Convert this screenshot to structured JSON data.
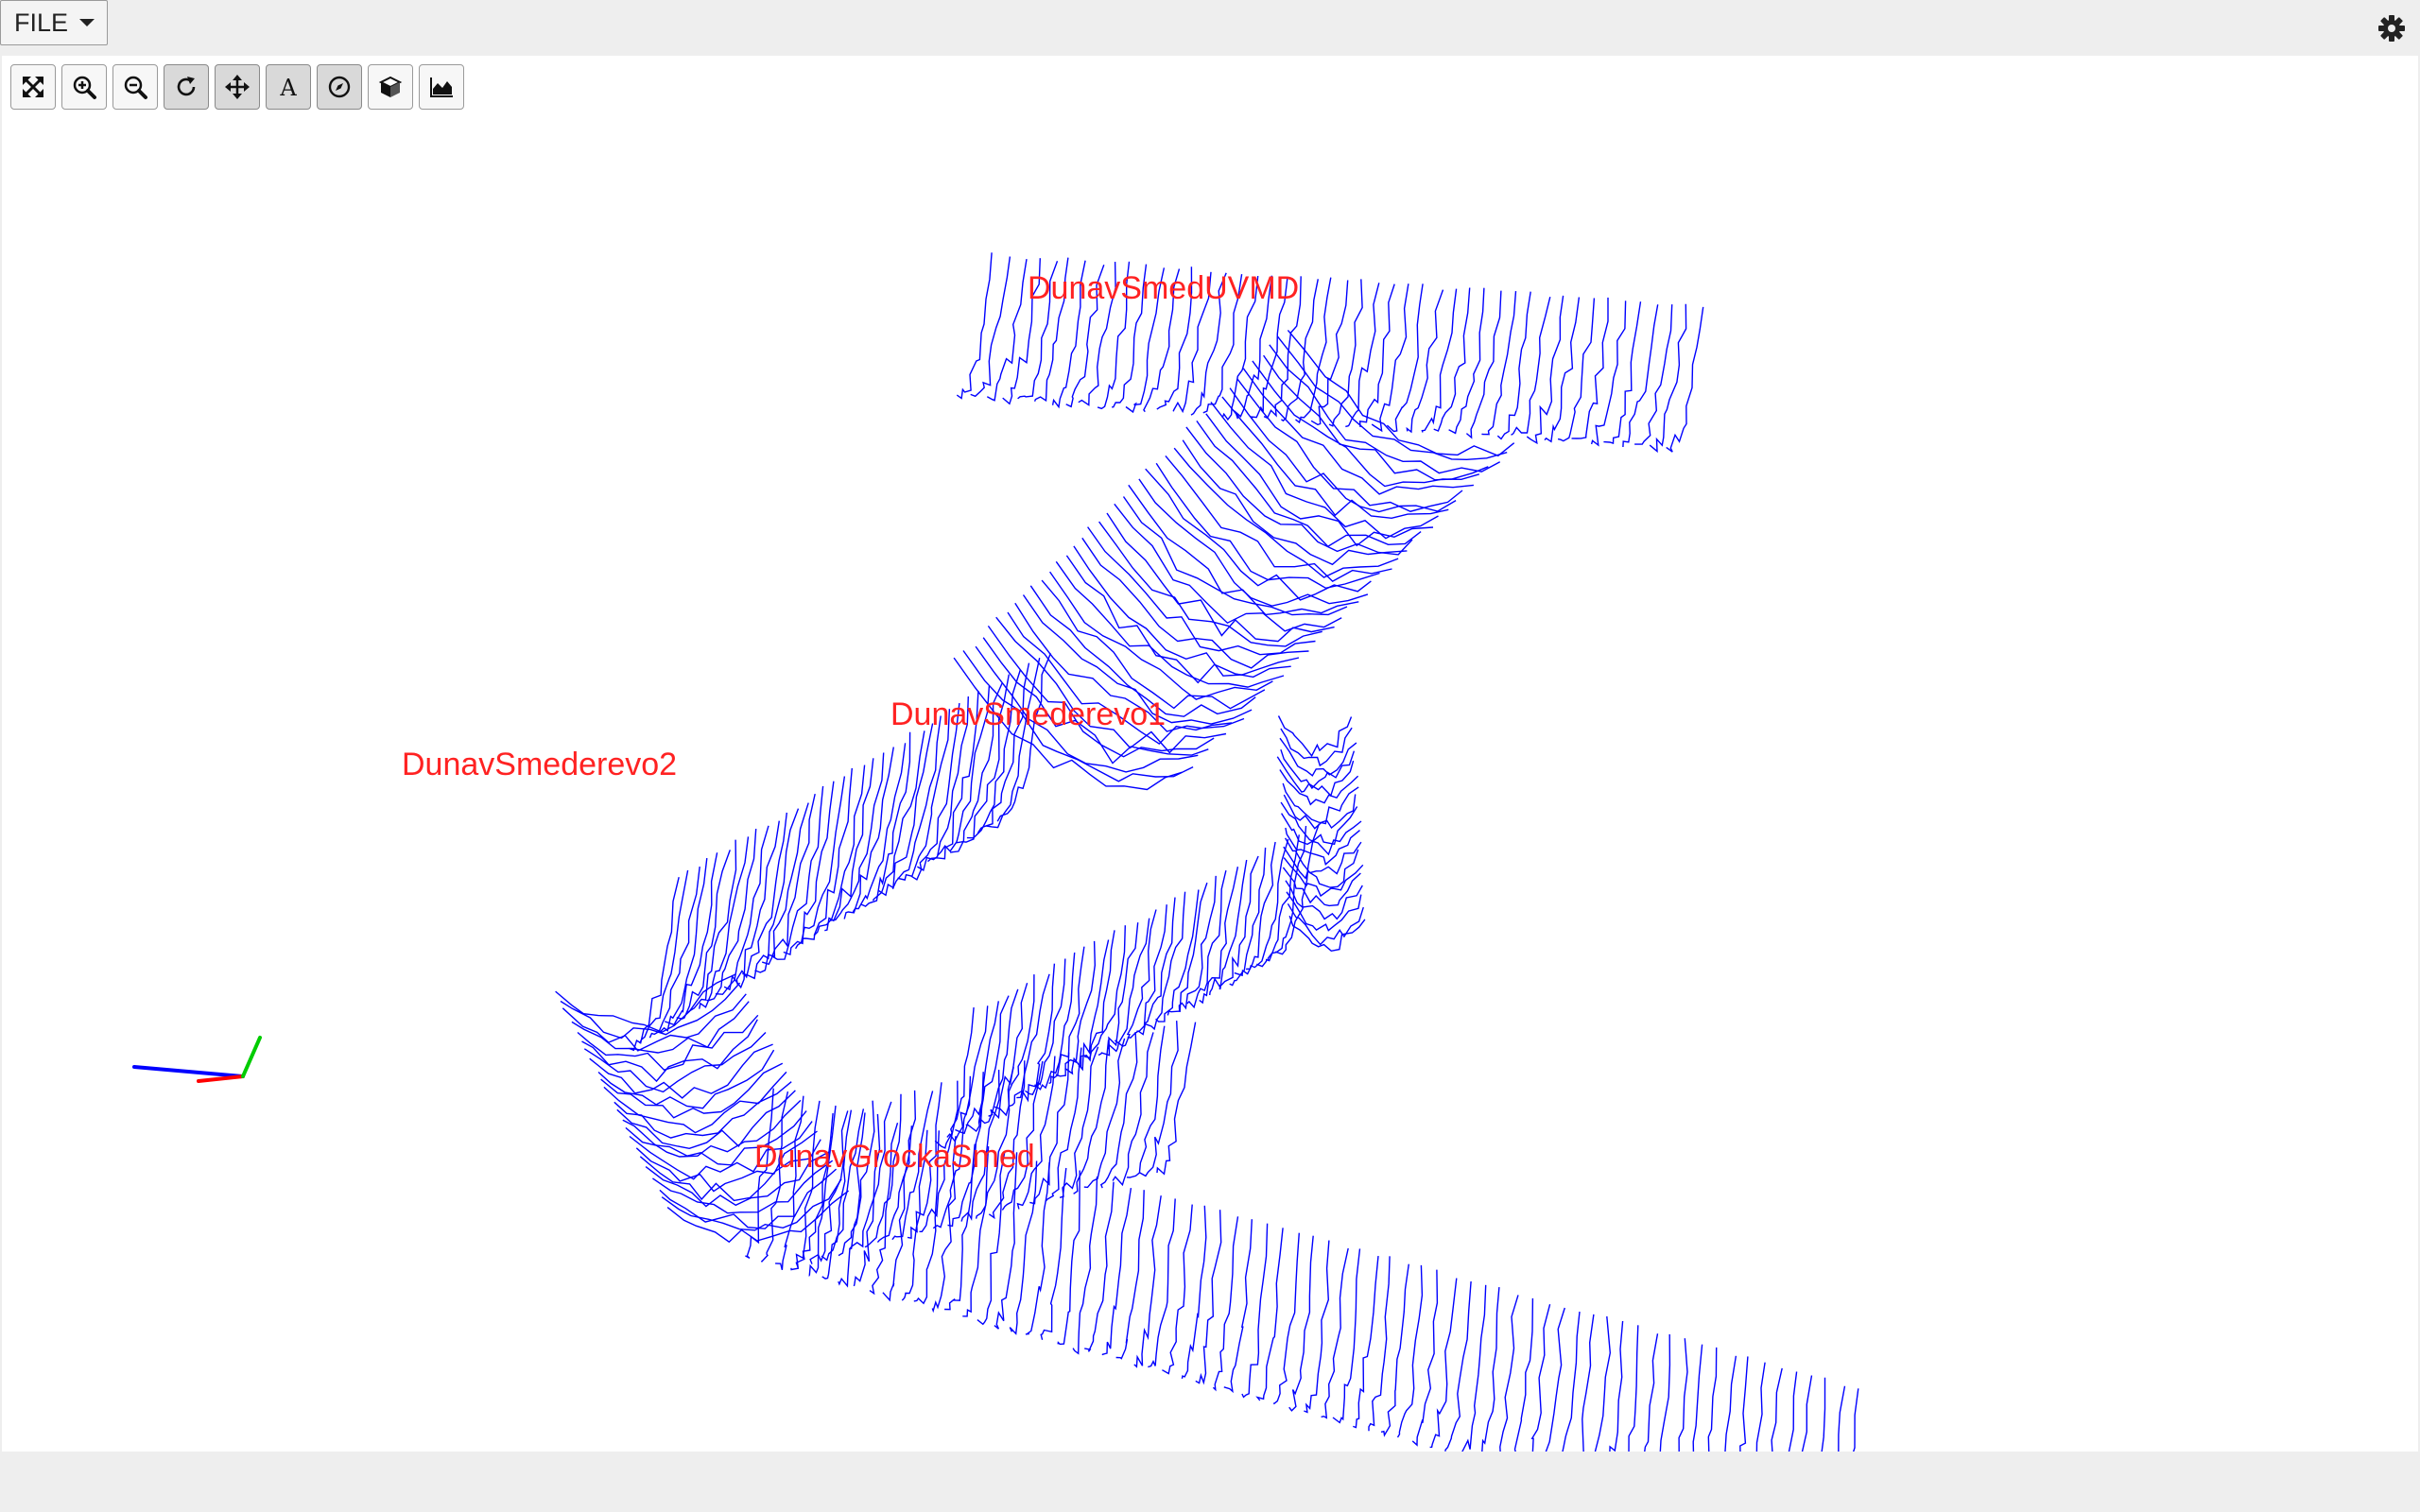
{
  "menu": {
    "file_label": "FILE"
  },
  "settings_icon": "gear-icon",
  "toolbar": [
    {
      "name": "fit-view-button",
      "icon": "expand-arrows-icon",
      "active": false
    },
    {
      "name": "zoom-in-button",
      "icon": "zoom-in-icon",
      "active": false
    },
    {
      "name": "zoom-out-button",
      "icon": "zoom-out-icon",
      "active": false
    },
    {
      "name": "rotate-button",
      "icon": "rotate-icon",
      "active": true
    },
    {
      "name": "pan-button",
      "icon": "move-arrows-icon",
      "active": true
    },
    {
      "name": "labels-toggle-button",
      "icon": "text-a-icon",
      "active": true
    },
    {
      "name": "compass-button",
      "icon": "compass-icon",
      "active": true
    },
    {
      "name": "cube-view-button",
      "icon": "cube-icon",
      "active": false
    },
    {
      "name": "terrain-button",
      "icon": "area-chart-icon",
      "active": false
    }
  ],
  "scene": {
    "labels": [
      "DunavSmedUVMD",
      "DunavSmederevo1",
      "DunavSmederevo2",
      "DunavGrockaSmed"
    ],
    "mesh_color": "#0000ff",
    "label_color": "#ff2222",
    "axes_colors": {
      "x": "#ff0000",
      "y": "#00cc00",
      "z": "#0000ff"
    }
  }
}
